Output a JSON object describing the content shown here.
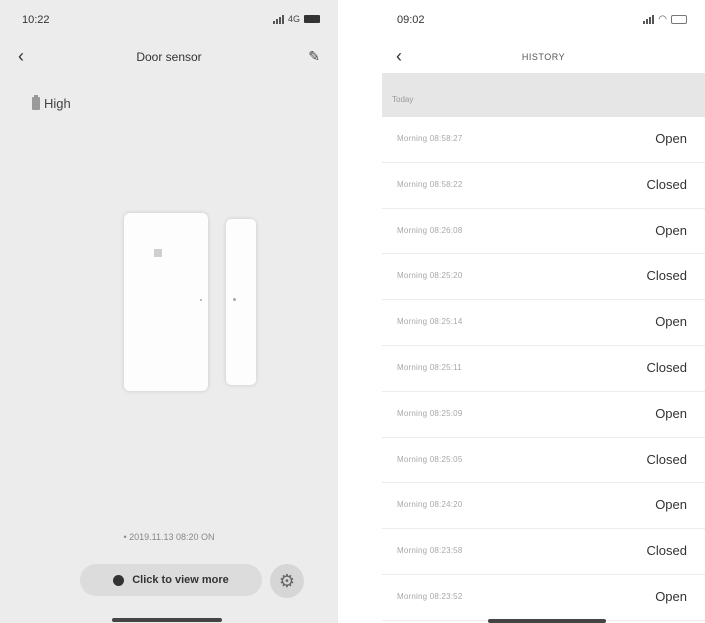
{
  "left": {
    "status": {
      "time": "10:22",
      "network": "4G"
    },
    "title": "Door sensor",
    "battery": "High",
    "last_event": "• 2019.11.13 08:20 ON",
    "more_label": "Click to view more"
  },
  "right": {
    "status": {
      "time": "09:02"
    },
    "title": "HISTORY",
    "day": "Today",
    "rows": [
      {
        "time": "Morning 08:58:27",
        "status": "Open"
      },
      {
        "time": "Morning 08:58:22",
        "status": "Closed"
      },
      {
        "time": "Morning 08:26:08",
        "status": "Open"
      },
      {
        "time": "Morning 08:25:20",
        "status": "Closed"
      },
      {
        "time": "Morning 08:25:14",
        "status": "Open"
      },
      {
        "time": "Morning 08:25:11",
        "status": "Closed"
      },
      {
        "time": "Morning 08:25:09",
        "status": "Open"
      },
      {
        "time": "Morning 08:25:05",
        "status": "Closed"
      },
      {
        "time": "Morning 08:24:20",
        "status": "Open"
      },
      {
        "time": "Morning 08:23:58",
        "status": "Closed"
      },
      {
        "time": "Morning 08:23:52",
        "status": "Open"
      }
    ]
  },
  "icons": {
    "back": "chevron-left",
    "edit": "pencil",
    "settings": "gear",
    "battery_level": "battery"
  }
}
